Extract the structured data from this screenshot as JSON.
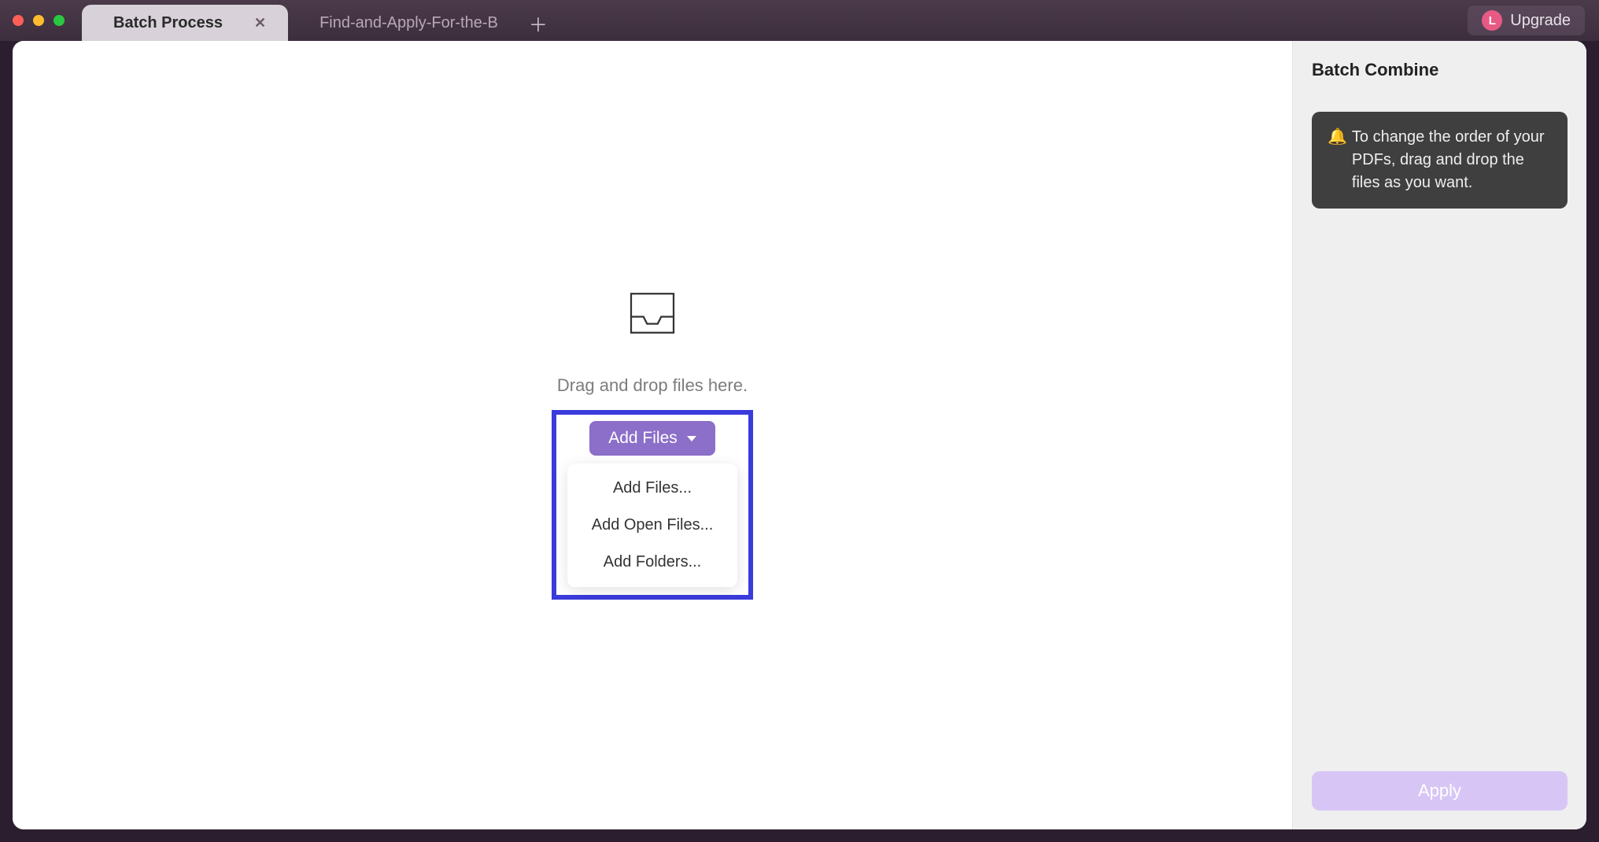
{
  "tabs": [
    {
      "label": "Batch Process",
      "active": true
    },
    {
      "label": "Find-and-Apply-For-the-B",
      "active": false
    }
  ],
  "upgrade": {
    "avatar_letter": "L",
    "label": "Upgrade"
  },
  "dropzone": {
    "hint": "Drag and drop files here.",
    "button_label": "Add Files",
    "menu": [
      "Add Files...",
      "Add Open Files...",
      "Add Folders..."
    ]
  },
  "sidebar": {
    "title": "Batch Combine",
    "tip_icon": "🔔",
    "tip_text": "To change the order of your PDFs, drag and drop the files as you want.",
    "apply_label": "Apply"
  }
}
